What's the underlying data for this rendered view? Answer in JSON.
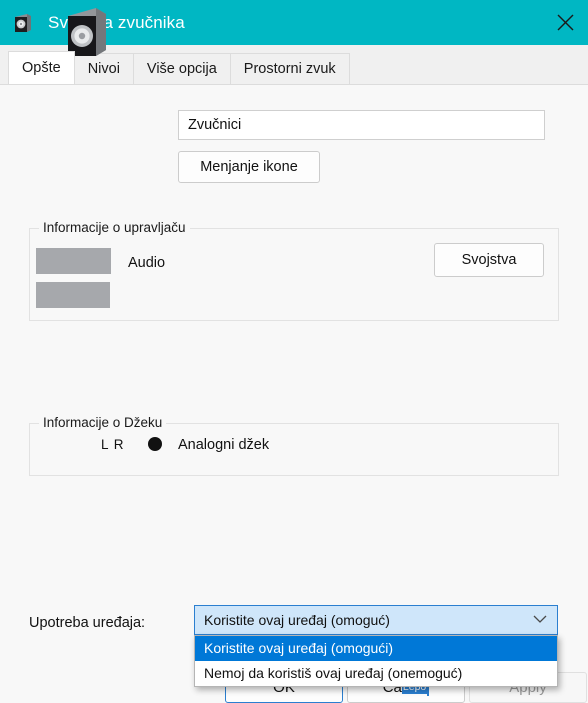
{
  "window": {
    "title": "Svojstva zvučnika",
    "titlebar_color": "#00b7c3",
    "icon": "speaker-icon",
    "close_icon": "close-icon"
  },
  "tabs": [
    {
      "label": "Opšte",
      "active": true
    },
    {
      "label": "Nivoi",
      "active": false
    },
    {
      "label": "Više opcija",
      "active": false
    },
    {
      "label": "Prostorni zvuk",
      "active": false
    }
  ],
  "general": {
    "device_icon": "speaker-icon",
    "name_value": "Zvučnici",
    "name_placeholder": "Zvučnici",
    "change_icon_label": "Menjanje ikone"
  },
  "driver_group": {
    "title": "Informacije o upravljaču",
    "line1_redacted": "",
    "line1_suffix": "Audio",
    "line2_redacted": "",
    "properties_label": "Svojstva"
  },
  "jack_group": {
    "title": "Informacije o Džeku",
    "channels": "L R",
    "jack_dot": "jack-dot-icon",
    "jack_label": "Analogni džek"
  },
  "device_usage": {
    "label": "Upotreba uređaja:",
    "selected": "Koristite ovaj uređaj (omoguć)",
    "chevron_icon": "chevron-down-icon",
    "options": [
      {
        "label": "Koristite ovaj uređaj (omogući)",
        "selected": true
      },
      {
        "label": "Nemoj da koristiš ovaj uređaj (onemoguć)",
        "selected": false
      }
    ]
  },
  "footer": {
    "ok_label": "OK",
    "cancel_prefix": "Ca",
    "cancel_selected_text": "Lepo",
    "apply_label": "Apply",
    "apply_disabled": true
  }
}
